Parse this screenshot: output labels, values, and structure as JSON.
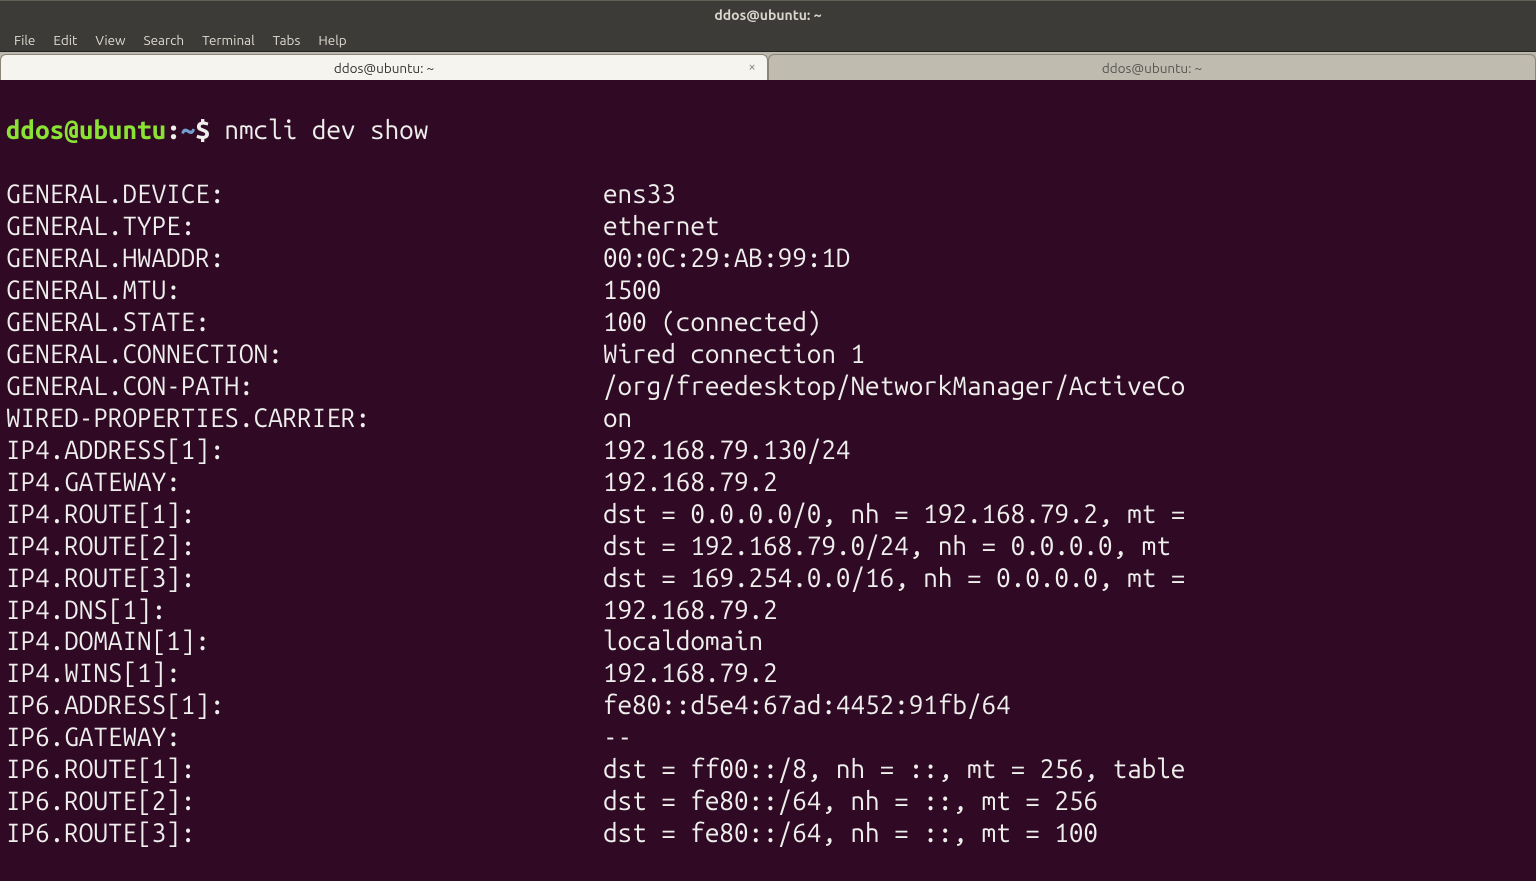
{
  "window": {
    "title": "ddos@ubuntu: ~"
  },
  "menubar": {
    "items": [
      "File",
      "Edit",
      "View",
      "Search",
      "Terminal",
      "Tabs",
      "Help"
    ]
  },
  "tabs": [
    {
      "label": "ddos@ubuntu: ~",
      "active": true
    },
    {
      "label": "ddos@ubuntu: ~",
      "active": false
    }
  ],
  "prompt": {
    "user": "ddos",
    "at": "@",
    "host": "ubuntu",
    "colon": ":",
    "path": "~",
    "dollar": "$",
    "command": " nmcli dev show"
  },
  "output": [
    {
      "key": "GENERAL.DEVICE:",
      "value": "ens33"
    },
    {
      "key": "GENERAL.TYPE:",
      "value": "ethernet"
    },
    {
      "key": "GENERAL.HWADDR:",
      "value": "00:0C:29:AB:99:1D"
    },
    {
      "key": "GENERAL.MTU:",
      "value": "1500"
    },
    {
      "key": "GENERAL.STATE:",
      "value": "100 (connected)"
    },
    {
      "key": "GENERAL.CONNECTION:",
      "value": "Wired connection 1"
    },
    {
      "key": "GENERAL.CON-PATH:",
      "value": "/org/freedesktop/NetworkManager/ActiveCo"
    },
    {
      "key": "WIRED-PROPERTIES.CARRIER:",
      "value": "on"
    },
    {
      "key": "IP4.ADDRESS[1]:",
      "value": "192.168.79.130/24"
    },
    {
      "key": "IP4.GATEWAY:",
      "value": "192.168.79.2"
    },
    {
      "key": "IP4.ROUTE[1]:",
      "value": "dst = 0.0.0.0/0, nh = 192.168.79.2, mt ="
    },
    {
      "key": "IP4.ROUTE[2]:",
      "value": "dst = 192.168.79.0/24, nh = 0.0.0.0, mt"
    },
    {
      "key": "IP4.ROUTE[3]:",
      "value": "dst = 169.254.0.0/16, nh = 0.0.0.0, mt ="
    },
    {
      "key": "IP4.DNS[1]:",
      "value": "192.168.79.2"
    },
    {
      "key": "IP4.DOMAIN[1]:",
      "value": "localdomain"
    },
    {
      "key": "IP4.WINS[1]:",
      "value": "192.168.79.2"
    },
    {
      "key": "IP6.ADDRESS[1]:",
      "value": "fe80::d5e4:67ad:4452:91fb/64"
    },
    {
      "key": "IP6.GATEWAY:",
      "value": "--"
    },
    {
      "key": "IP6.ROUTE[1]:",
      "value": "dst = ff00::/8, nh = ::, mt = 256, table"
    },
    {
      "key": "IP6.ROUTE[2]:",
      "value": "dst = fe80::/64, nh = ::, mt = 256"
    },
    {
      "key": "IP6.ROUTE[3]:",
      "value": "dst = fe80::/64, nh = ::, mt = 100"
    }
  ]
}
